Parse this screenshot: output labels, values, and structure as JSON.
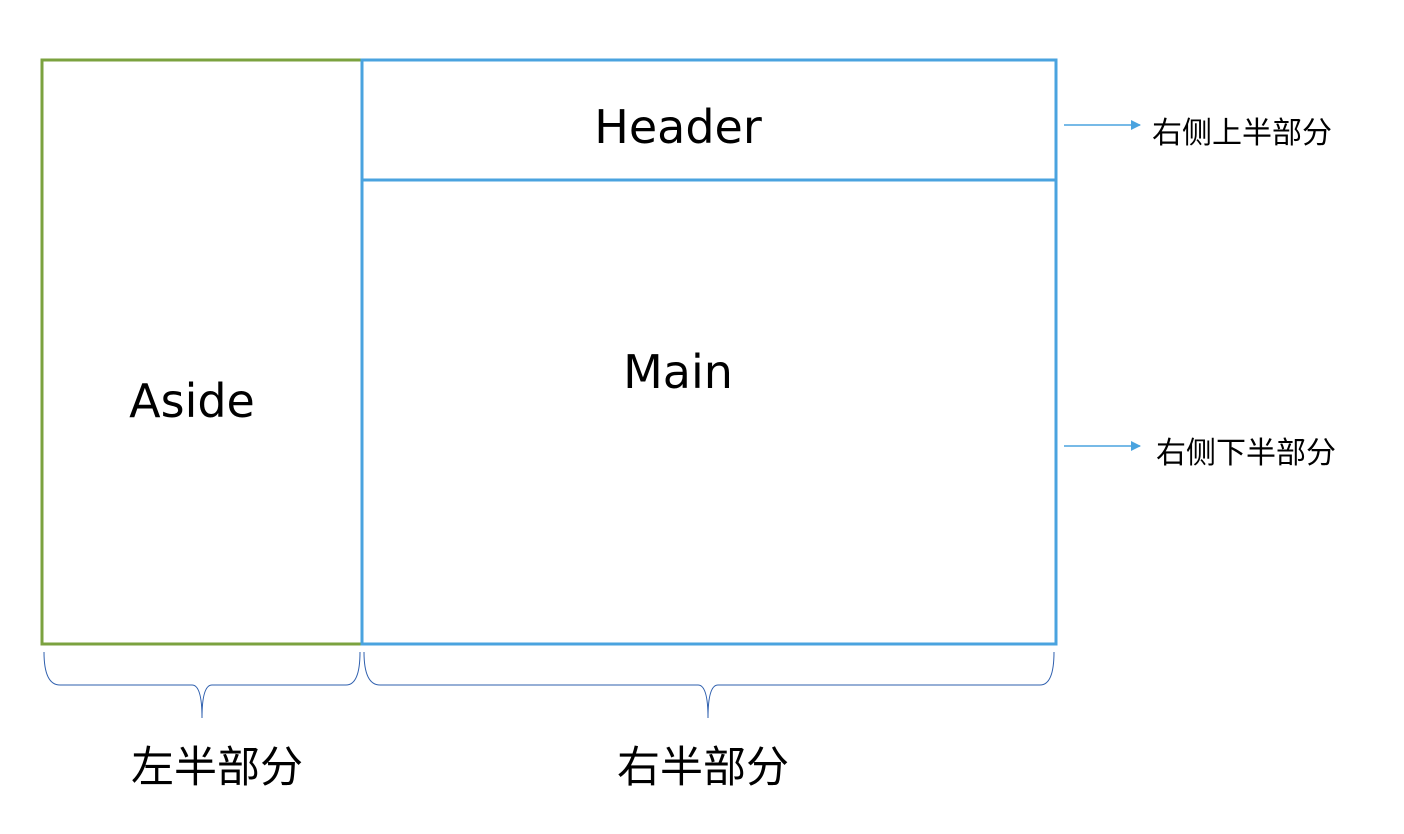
{
  "colors": {
    "aside_border": "#7ba23f",
    "right_border": "#4aa3df",
    "arrow": "#4aa3df",
    "brace": "#2e5fae"
  },
  "aside": {
    "label": "Aside"
  },
  "header": {
    "label": "Header"
  },
  "main": {
    "label": "Main"
  },
  "annotations": {
    "upper_right": "右侧上半部分",
    "lower_right": "右侧下半部分"
  },
  "braces": {
    "left": "左半部分",
    "right": "右半部分"
  }
}
